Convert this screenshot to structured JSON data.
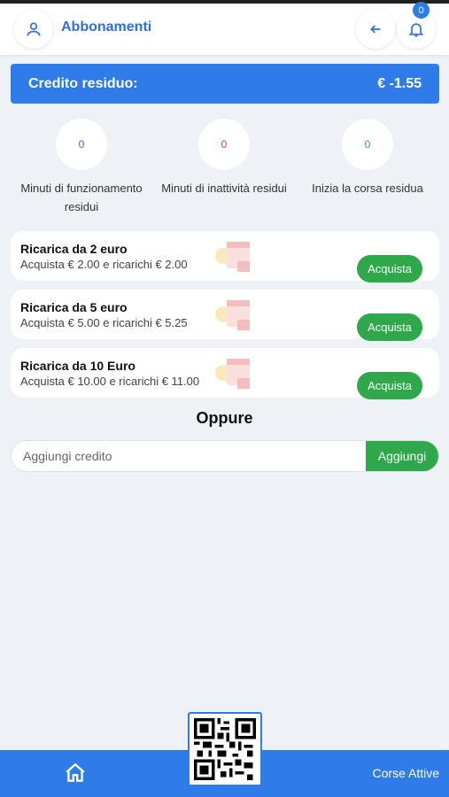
{
  "header": {
    "title": "Abbonamenti",
    "notification_count": "0"
  },
  "credit": {
    "label": "Credito residuo:",
    "value": "€ -1.55"
  },
  "stats": [
    {
      "value": "0",
      "label": "Minuti di funzionamento residui",
      "color": "#2f6fde"
    },
    {
      "value": "0",
      "label": "Minuti di inattività residui",
      "color": "#e04848"
    },
    {
      "value": "0",
      "label": "Inizia la corsa residua",
      "color": "#2ea84a"
    }
  ],
  "packages": [
    {
      "title": "Ricarica da 2 euro",
      "subtitle": "Acquista € 2.00 e ricarichi € 2.00",
      "button": "Acquista"
    },
    {
      "title": "Ricarica da 5 euro",
      "subtitle": "Acquista € 5.00 e ricarichi € 5.25",
      "button": "Acquista"
    },
    {
      "title": "Ricarica da 10 Euro",
      "subtitle": "Acquista € 10.00 e ricarichi € 11.00",
      "button": "Acquista"
    }
  ],
  "alternative": {
    "label": "Oppure"
  },
  "add_credit": {
    "placeholder": "Aggiungi credito",
    "button": "Aggiungi"
  },
  "bottom_nav": {
    "right_label": "Corse Attive",
    "home_icon": "home-icon",
    "qr_icon": "qr-code-icon"
  },
  "colors": {
    "primary": "#2f7be8",
    "accent_green": "#2ea84a",
    "background": "#eef1f5"
  }
}
